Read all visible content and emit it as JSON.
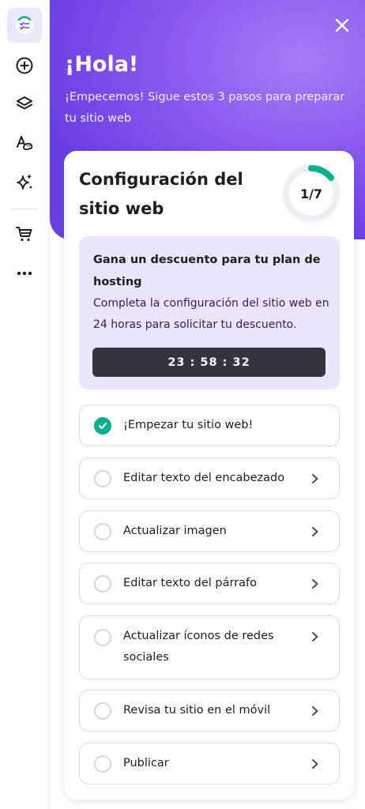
{
  "sidebar": {
    "items": [
      {
        "icon": "checklist-icon",
        "active": true
      },
      {
        "icon": "add-circle-icon"
      },
      {
        "icon": "layers-icon"
      },
      {
        "icon": "styles-palette-icon"
      },
      {
        "icon": "ai-sparkle-icon"
      },
      {
        "icon": "cart-icon"
      },
      {
        "icon": "more-dots-icon"
      }
    ]
  },
  "hero": {
    "title": "¡Hola!",
    "subtitle": "¡Empecemos! Sigue estos 3 pasos para preparar tu sitio web",
    "close_icon": "close-icon"
  },
  "card": {
    "title": "Configuración del sitio web",
    "progress": {
      "label": "1/7",
      "completed": 1,
      "total": 7
    }
  },
  "promo": {
    "title": "Gana un descuento para tu plan de hosting",
    "text": "Completa la configuración del sitio web en 24 horas para solicitar tu descuento.",
    "timer": "23 : 58 : 32"
  },
  "steps": [
    {
      "label": "¡Empezar tu sitio web!",
      "done": true
    },
    {
      "label": "Editar texto del encabezado",
      "done": false
    },
    {
      "label": "Actualizar imagen",
      "done": false
    },
    {
      "label": "Editar texto del párrafo",
      "done": false
    },
    {
      "label": "Actualizar íconos de redes sociales",
      "done": false
    },
    {
      "label": "Revisa tu sitio en el móvil",
      "done": false
    },
    {
      "label": "Publicar",
      "done": false
    }
  ],
  "colors": {
    "accent": "#673de6",
    "success": "#00b090",
    "promo_bg": "#ebe6fc",
    "timer_bg": "#34343f"
  }
}
